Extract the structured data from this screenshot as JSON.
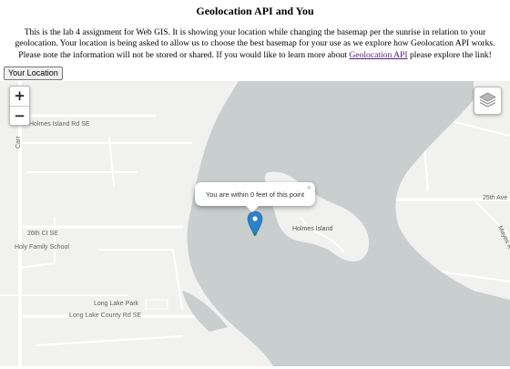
{
  "header": {
    "title": "Geolocation API and You"
  },
  "intro": {
    "text_before_link": "This is the lab 4 assignment for Web GIS. It is showing your location while changing the basemap per the sunrise in relation to your geolocation. Your location is being asked to allow us to choose the best basemap for your use as we explore how Geolocation API works. Please note the information will not be stored or shared. If you would like to learn more about ",
    "link_text": "Geolocation API",
    "text_after_link": " please explore the link!"
  },
  "controls": {
    "location_button": "Your Location",
    "zoom_in": "+",
    "zoom_out": "−"
  },
  "map": {
    "popup_text": "You are within 0 feet of this point",
    "popup_close": "×",
    "labels": {
      "holmes_island_rd": "Holmes Island Rd SE",
      "carr": "Carr",
      "twenty_sixth_ct": "26th Ct SE",
      "holy_family_school": "Holy Family School",
      "holmes_island": "Holmes Island",
      "twenty_fifth_ave": "25th Ave",
      "mayes_rd": "Mayes R",
      "long_lake_park": "Long Lake Park",
      "long_lake_county_rd": "Long Lake County Rd SE"
    },
    "colors": {
      "land": "#f1f1ef",
      "water": "#c9cfcf",
      "road": "#ffffff",
      "marker": "#2b82cb"
    }
  }
}
